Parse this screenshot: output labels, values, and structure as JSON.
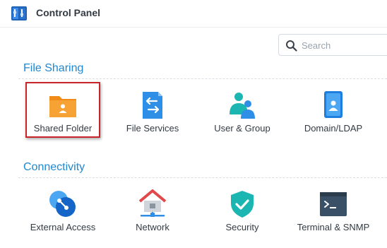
{
  "window": {
    "title": "Control Panel",
    "app_icon": "control-panel-icon"
  },
  "search": {
    "placeholder": "Search",
    "value": "",
    "icon": "search-icon"
  },
  "sections": [
    {
      "title": "File Sharing",
      "items": [
        {
          "label": "Shared Folder",
          "icon": "shared-folder-icon",
          "selected": true
        },
        {
          "label": "File Services",
          "icon": "file-services-icon",
          "selected": false
        },
        {
          "label": "User & Group",
          "icon": "user-group-icon",
          "selected": false
        },
        {
          "label": "Domain/LDAP",
          "icon": "domain-ldap-icon",
          "selected": false
        }
      ]
    },
    {
      "title": "Connectivity",
      "items": [
        {
          "label": "External Access",
          "icon": "external-access-icon",
          "selected": false
        },
        {
          "label": "Network",
          "icon": "network-icon",
          "selected": false
        },
        {
          "label": "Security",
          "icon": "security-icon",
          "selected": false
        },
        {
          "label": "Terminal & SNMP",
          "icon": "terminal-snmp-icon",
          "selected": false
        }
      ]
    }
  ],
  "colors": {
    "accent": "#1e88d4",
    "selection_border": "#c8252b",
    "folder_orange": "#f7a234",
    "icon_blue": "#2f8fe6",
    "icon_teal": "#1bb6b1",
    "network_red": "#e0484a"
  }
}
